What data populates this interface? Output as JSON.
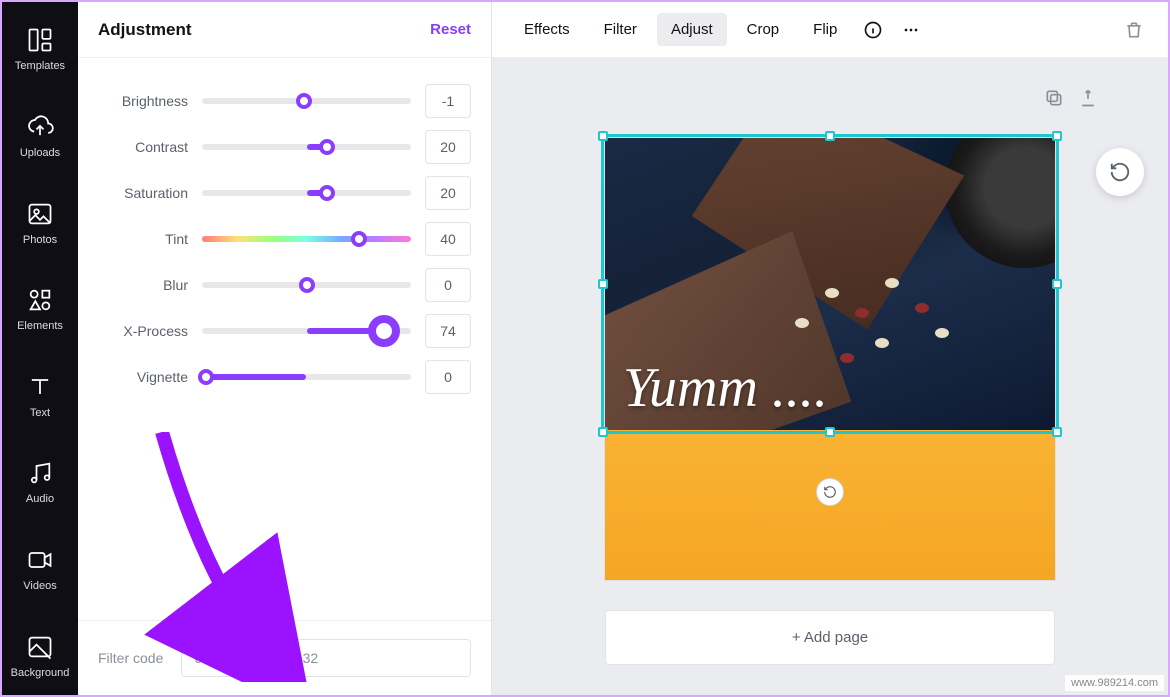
{
  "rail": [
    {
      "label": "Templates",
      "icon": "templates"
    },
    {
      "label": "Uploads",
      "icon": "uploads"
    },
    {
      "label": "Photos",
      "icon": "photos"
    },
    {
      "label": "Elements",
      "icon": "elements"
    },
    {
      "label": "Text",
      "icon": "text"
    },
    {
      "label": "Audio",
      "icon": "audio"
    },
    {
      "label": "Videos",
      "icon": "videos"
    },
    {
      "label": "Background",
      "icon": "background"
    }
  ],
  "panel": {
    "title": "Adjustment",
    "reset": "Reset",
    "sliders": [
      {
        "label": "Brightness",
        "value": "-1",
        "pos": 49,
        "gradient": false
      },
      {
        "label": "Contrast",
        "value": "20",
        "pos": 60,
        "gradient": false
      },
      {
        "label": "Saturation",
        "value": "20",
        "pos": 60,
        "gradient": false
      },
      {
        "label": "Tint",
        "value": "40",
        "pos": 75,
        "gradient": true
      },
      {
        "label": "Blur",
        "value": "0",
        "pos": 50,
        "gradient": false
      },
      {
        "label": "X-Process",
        "value": "74",
        "pos": 87,
        "gradient": false,
        "big": true
      },
      {
        "label": "Vignette",
        "value": "0",
        "pos": 2,
        "gradient": false
      }
    ],
    "filter_code_label": "Filter code",
    "filter_code_value": "6378788c6400ae32"
  },
  "toolbar": {
    "items": [
      "Effects",
      "Filter",
      "Adjust",
      "Crop",
      "Flip"
    ],
    "active": "Adjust"
  },
  "canvas": {
    "heading_text": "Yumm ....",
    "add_page": "+ Add page"
  },
  "watermark": "www.989214.com"
}
